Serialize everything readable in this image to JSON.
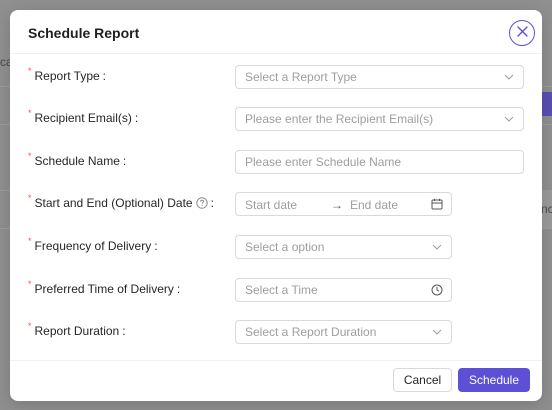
{
  "background": {
    "left_fragment": "ca",
    "right_fragment": "nc"
  },
  "dialog": {
    "title": "Schedule Report",
    "close_icon": "close-icon"
  },
  "form": {
    "report_type": {
      "label": "Report Type",
      "placeholder": "Select a Report Type",
      "icon": "chevron-down-icon"
    },
    "recipient_emails": {
      "label": "Recipient Email(s)",
      "placeholder": "Please enter the Recipient Email(s)",
      "icon": "chevron-down-icon"
    },
    "schedule_name": {
      "label": "Schedule Name",
      "placeholder": "Please enter Schedule Name"
    },
    "date_range": {
      "label": "Start and End (Optional) Date",
      "start_placeholder": "Start date",
      "end_placeholder": "End date",
      "separator": "→",
      "help_icon": "question-circle-icon",
      "icon": "calendar-icon"
    },
    "frequency": {
      "label": "Frequency of Delivery",
      "placeholder": "Select a option",
      "icon": "chevron-down-icon"
    },
    "preferred_time": {
      "label": "Preferred Time of Delivery",
      "placeholder": "Select a Time",
      "icon": "clock-icon"
    },
    "report_duration": {
      "label": "Report Duration",
      "placeholder": "Select a Report Duration",
      "icon": "chevron-down-icon"
    },
    "required_marker": "*",
    "colon": ":"
  },
  "footer": {
    "cancel_label": "Cancel",
    "submit_label": "Schedule"
  },
  "colors": {
    "accent": "#5b50d6",
    "required": "#ff4d4f",
    "border": "#d9d9d9",
    "placeholder": "#9e9e9e"
  }
}
